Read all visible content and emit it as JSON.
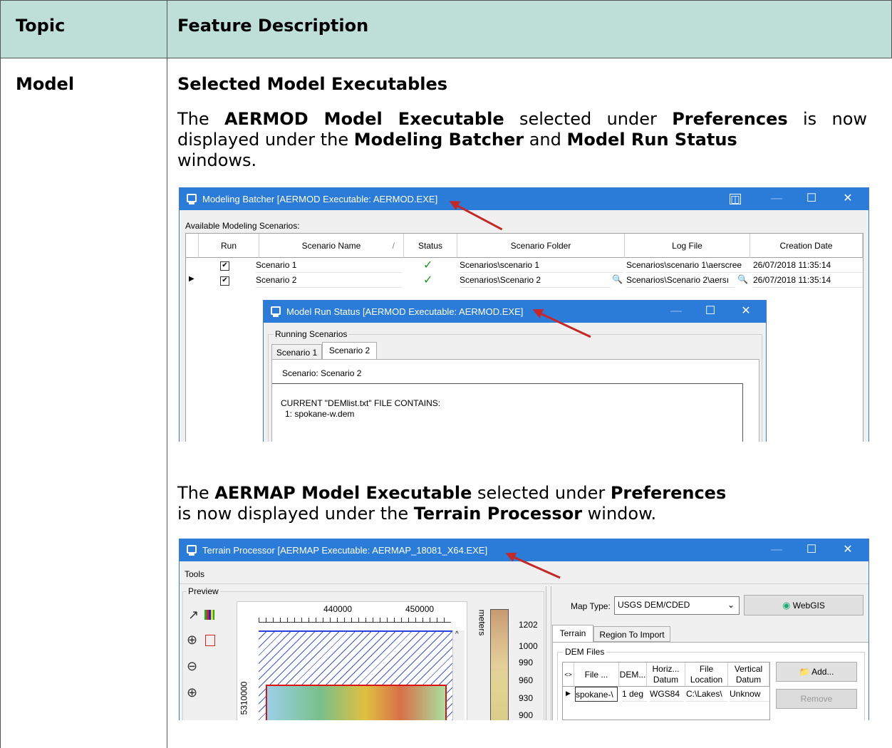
{
  "table": {
    "header_topic": "Topic",
    "header_feature": "Feature Description",
    "row_topic": "Model",
    "row_title": "Selected Model Executables",
    "para1": {
      "t1": "The ",
      "b1": "AERMOD Model Executable",
      "t2": " selected under ",
      "b2": "Preferences",
      "t3": " is now displayed under the ",
      "b3": "Modeling Batcher",
      "t4": " and ",
      "b4": "Model Run Status",
      "t5": "windows."
    },
    "para2": {
      "t1": "The ",
      "b1": "AERMAP Model Executable",
      "t2": " selected under ",
      "b2": "Preferences",
      "t3": " is now displayed under the ",
      "b3": "Terrain Processor",
      "t4": " window."
    }
  },
  "batcher": {
    "title": "Modeling Batcher [AERMOD Executable: AERMOD.EXE]",
    "available_label": "Available Modeling Scenarios:",
    "columns": [
      "Run",
      "Scenario Name",
      "Status",
      "Scenario Folder",
      "Log File",
      "Creation Date"
    ],
    "sort_indicator": "/",
    "rows": [
      {
        "run": "✔",
        "name": "Scenario 1",
        "status": "✓",
        "folder": "Scenarios\\scenario 1",
        "log": "Scenarios\\scenario 1\\aerscree",
        "date": "26/07/2018 11:35:14"
      },
      {
        "run": "✔",
        "name": "Scenario 2",
        "status": "✓",
        "folder": "Scenarios\\Scenario 2",
        "log": "Scenarios\\Scenario 2\\aersı",
        "date": "26/07/2018 11:35:14"
      }
    ]
  },
  "runstatus": {
    "title": "Model Run Status [AERMOD Executable: AERMOD.EXE]",
    "group_label": "Running Scenarios",
    "tabs": [
      "Scenario 1",
      "Scenario 2"
    ],
    "scenario_line": "Scenario: Scenario 2",
    "log_line1": "CURRENT \"DEMlist.txt\" FILE CONTAINS:",
    "log_line2": "1: spokane-w.dem"
  },
  "terrain": {
    "title": "Terrain Processor [AERMAP Executable: AERMAP_18081_X64.EXE]",
    "menu_tools": "Tools",
    "preview_label": "Preview",
    "x_ticks": [
      "440000",
      "450000"
    ],
    "y_tick": "5310000",
    "legend_unit": "meters",
    "legend_values": [
      "1202",
      "1000",
      "990",
      "960",
      "930",
      "900"
    ],
    "map_type_label": "Map Type:",
    "map_type_value": "USGS DEM/CDED",
    "webgis_label": "WebGIS",
    "tabs": [
      "Terrain",
      "Region To Import"
    ],
    "dem_files_label": "DEM Files",
    "dem_columns": [
      "<>",
      "File ...",
      "DEM...",
      "Horiz... Datum",
      "File Location",
      "Vertical Datum"
    ],
    "dem_row": [
      "spokane-\\",
      "1 deg",
      "WGS84",
      "C:\\Lakes\\",
      "Unknow"
    ],
    "add_label": "Add...",
    "remove_label": "Remove"
  }
}
